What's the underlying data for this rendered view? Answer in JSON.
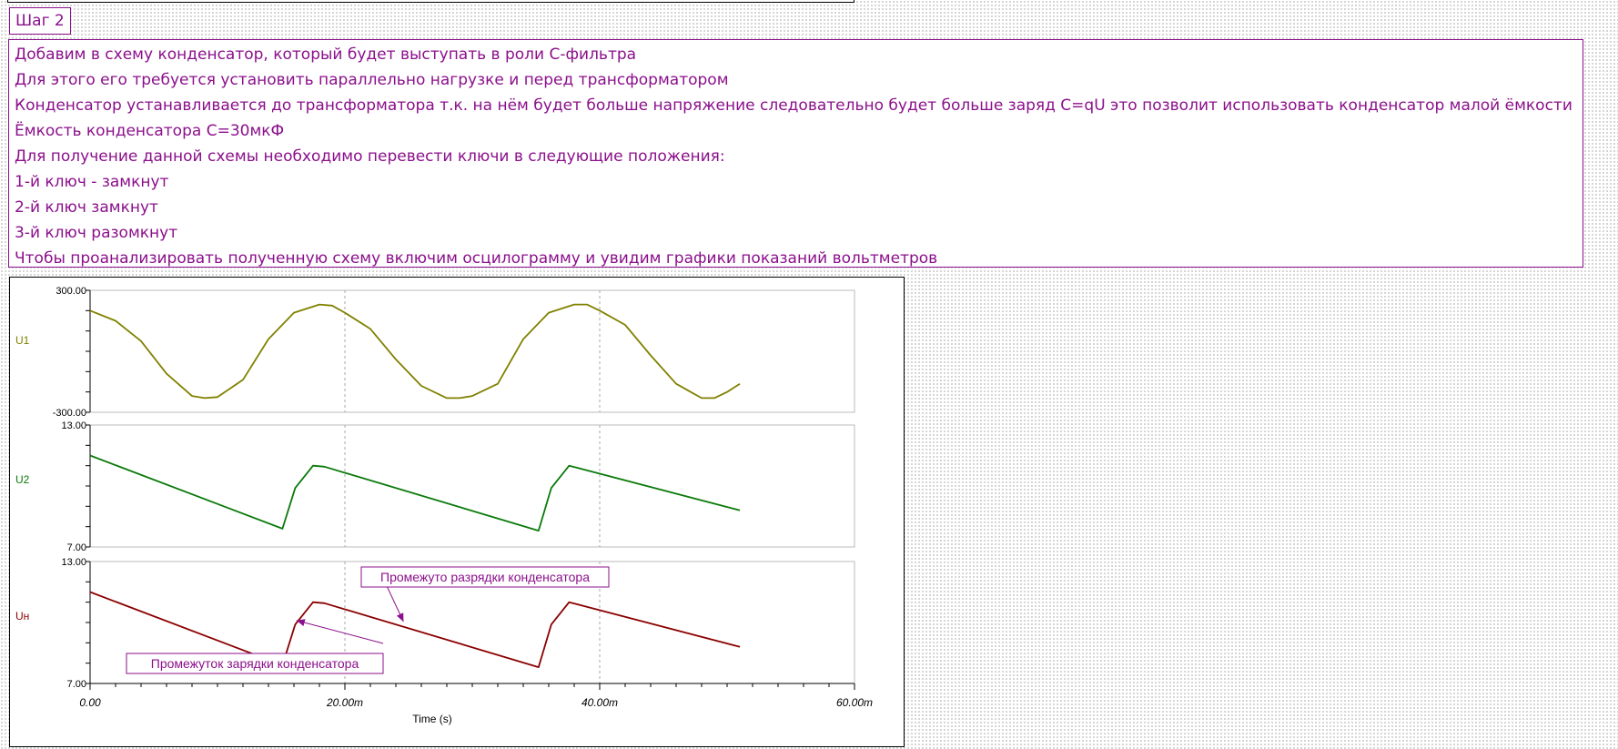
{
  "step": {
    "title": "Шаг 2"
  },
  "description": {
    "lines": [
      "Добавим в схему конденсатор, который будет выступать в роли C-фильтра",
      "Для этого его требуется установить параллельно нагрузке и перед трансформатором",
      "Конденсатор устанавливается до трансформатора т.к. на нём будет больше напряжение следовательно будет больше заряд C=qU это позволит использовать конденсатор малой ёмкости",
      "Ёмкость конденсатора C=30мкФ",
      "Для получение данной схемы необходимо перевести ключи в следующие положения:",
      "1-й ключ - замкнут",
      "2-й ключ замкнут",
      "3-й ключ разомкнут",
      "Чтобы проанализировать полученную схему включим  осцилограмму и увидим графики показаний вольтметров"
    ]
  },
  "colors": {
    "text": "#8b108b",
    "u1": "#808000",
    "u2": "#0a7a0a",
    "un": "#8b0000",
    "grid": "#aaaaaa",
    "axis": "#000000"
  },
  "chart_data": {
    "type": "line",
    "xlabel": "Time (s)",
    "xlim": [
      0,
      0.06
    ],
    "x_ticks": [
      0,
      0.02,
      0.04,
      0.06
    ],
    "x_tick_labels": [
      "0.00",
      "20.00m",
      "40.00m",
      "60.00m"
    ],
    "panels": [
      {
        "name": "U1",
        "ylim": [
          -300,
          300
        ],
        "y_tick_labels": [
          "300.00",
          "-300.00"
        ],
        "points": [
          [
            0,
            200
          ],
          [
            0.002,
            150
          ],
          [
            0.004,
            50
          ],
          [
            0.006,
            -110
          ],
          [
            0.008,
            -220
          ],
          [
            0.009,
            -230
          ],
          [
            0.01,
            -225
          ],
          [
            0.012,
            -140
          ],
          [
            0.014,
            60
          ],
          [
            0.016,
            190
          ],
          [
            0.018,
            230
          ],
          [
            0.019,
            225
          ],
          [
            0.02,
            190
          ],
          [
            0.022,
            110
          ],
          [
            0.024,
            -40
          ],
          [
            0.026,
            -170
          ],
          [
            0.028,
            -230
          ],
          [
            0.029,
            -230
          ],
          [
            0.03,
            -220
          ],
          [
            0.032,
            -160
          ],
          [
            0.034,
            60
          ],
          [
            0.036,
            190
          ],
          [
            0.038,
            230
          ],
          [
            0.039,
            230
          ],
          [
            0.04,
            200
          ],
          [
            0.042,
            130
          ],
          [
            0.044,
            -20
          ],
          [
            0.046,
            -160
          ],
          [
            0.048,
            -230
          ],
          [
            0.049,
            -230
          ],
          [
            0.05,
            -200
          ],
          [
            0.051,
            -160
          ]
        ]
      },
      {
        "name": "U2",
        "ylim": [
          7,
          13
        ],
        "y_tick_labels": [
          "13.00",
          "7.00"
        ],
        "points": [
          [
            0,
            11.5
          ],
          [
            0.0151,
            7.9
          ],
          [
            0.0161,
            9.9
          ],
          [
            0.0175,
            11.0
          ],
          [
            0.0184,
            10.95
          ],
          [
            0.0352,
            7.8
          ],
          [
            0.0362,
            9.9
          ],
          [
            0.0376,
            11.0
          ],
          [
            0.0382,
            10.9
          ],
          [
            0.051,
            8.8
          ]
        ]
      },
      {
        "name": "Uн",
        "ylim": [
          7,
          13
        ],
        "y_tick_labels": [
          "13.00",
          "7.00"
        ],
        "points": [
          [
            0,
            11.5
          ],
          [
            0.0151,
            7.9
          ],
          [
            0.0161,
            9.9
          ],
          [
            0.0175,
            11.0
          ],
          [
            0.0184,
            10.95
          ],
          [
            0.0352,
            7.8
          ],
          [
            0.0362,
            9.9
          ],
          [
            0.0376,
            11.0
          ],
          [
            0.0382,
            10.9
          ],
          [
            0.051,
            8.8
          ]
        ]
      }
    ],
    "annotations": [
      {
        "text": "Промежуто разрядки конденсатора",
        "panel": 2,
        "target": [
          0.0246,
          10.04
        ]
      },
      {
        "text": "Промежуток зарядки конденсатора",
        "panel": 2,
        "target": [
          0.0162,
          10.1
        ]
      }
    ]
  }
}
